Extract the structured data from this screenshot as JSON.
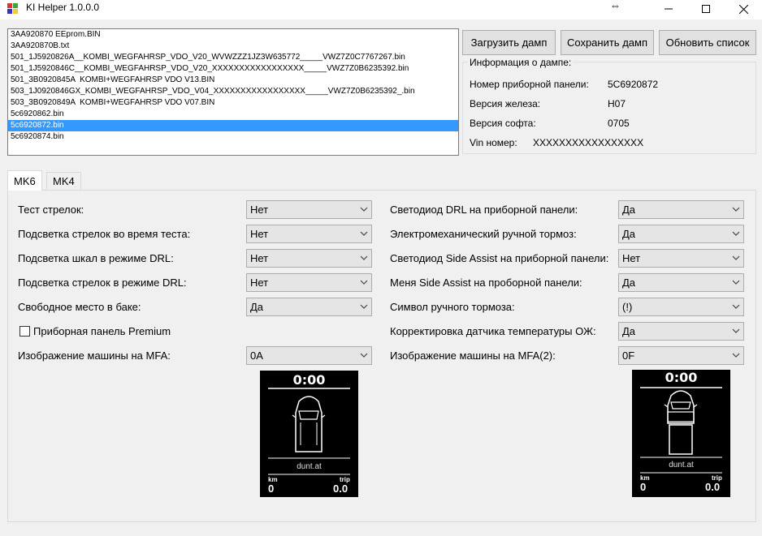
{
  "window": {
    "title": "KI Helper 1.0.0.0",
    "minimize_glyph": "—",
    "maximize_glyph": "☐",
    "close_glyph": "✕",
    "cursor_glyph": "⇔"
  },
  "files": {
    "items": [
      "3AA920870 EEprom.BIN",
      "3AA920870B.txt",
      "501_1J5920826A__KOMBI_WEGFAHRSP_VDO_V20_WVWZZZ1JZ3W635772_____VWZ7Z0C7767267.bin",
      "501_1J5920846C__KOMBI_WEGFAHRSP_VDO_V20_XXXXXXXXXXXXXXXXX_____VWZ7Z0B6235392.bin",
      "501_3B0920845A  KOMBI+WEGFAHRSP VDO V13.BIN",
      "503_1J0920846GX_KOMBI_WEGFAHRSP_VDO_V04_XXXXXXXXXXXXXXXXX_____VWZ7Z0B6235392_.bin",
      "503_3B0920849A  KOMBI+WEGFAHRSP VDO V07.BIN",
      "5c6920862.bin",
      "5c6920872.bin",
      "5c6920874.bin"
    ],
    "selected_index": 8
  },
  "buttons": {
    "load": "Загрузить дамп",
    "save": "Сохранить дамп",
    "refresh": "Обновить список"
  },
  "info": {
    "legend": "Информация о дампе:",
    "panel_number_label": "Номер приборной панели:",
    "panel_number_value": "5C6920872",
    "hw_label": "Версия железа:",
    "hw_value": "H07",
    "sw_label": "Версия софта:",
    "sw_value": "0705",
    "vin_label": "Vin номер:",
    "vin_value": "XXXXXXXXXXXXXXXXX"
  },
  "tabs": [
    {
      "label": "MK6",
      "active": true
    },
    {
      "label": "MK4",
      "active": false
    }
  ],
  "settings_left": [
    {
      "label": "Тест стрелок:",
      "value": "Нет"
    },
    {
      "label": "Подсветка стрелок во время теста:",
      "value": "Нет"
    },
    {
      "label": "Подсветка шкал в режиме DRL:",
      "value": "Нет"
    },
    {
      "label": "Подсветка стрелок в режиме DRL:",
      "value": "Нет"
    },
    {
      "label": "Свободное место в баке:",
      "value": "Да"
    }
  ],
  "checkbox_premium": {
    "label": "Приборная панель Premium",
    "checked": false
  },
  "mfa_left": {
    "label": "Изображение машины на MFA:",
    "value": "0A"
  },
  "settings_right": [
    {
      "label": "Светодиод DRL на приборной панели:",
      "value": "Да"
    },
    {
      "label": "Электромеханический ручной тормоз:",
      "value": "Да"
    },
    {
      "label": "Светодиод Side Assist на приборной панели:",
      "value": "Нет"
    },
    {
      "label": "Меня Side Assist на проборной панели:",
      "value": "Да"
    },
    {
      "label": "Символ ручного тормоза:",
      "value": "(!)"
    },
    {
      "label": "Корректировка датчика температуры ОЖ:",
      "value": "Да"
    }
  ],
  "mfa_right": {
    "label": "Изображение машины на MFA(2):",
    "value": "0F"
  },
  "preview_left": {
    "time": "0:00",
    "brand": "dunt.at",
    "km_label": "km",
    "km_value": "0",
    "trip_label": "trip",
    "trip_value": "0.0"
  },
  "preview_right": {
    "time": "0:00",
    "brand": "dunt.at",
    "km_label": "km",
    "km_value": "0",
    "trip_label": "trip",
    "trip_value": "0.0"
  },
  "colors": {
    "selection": "#3399ff",
    "window_bg": "#f0f0f0"
  }
}
